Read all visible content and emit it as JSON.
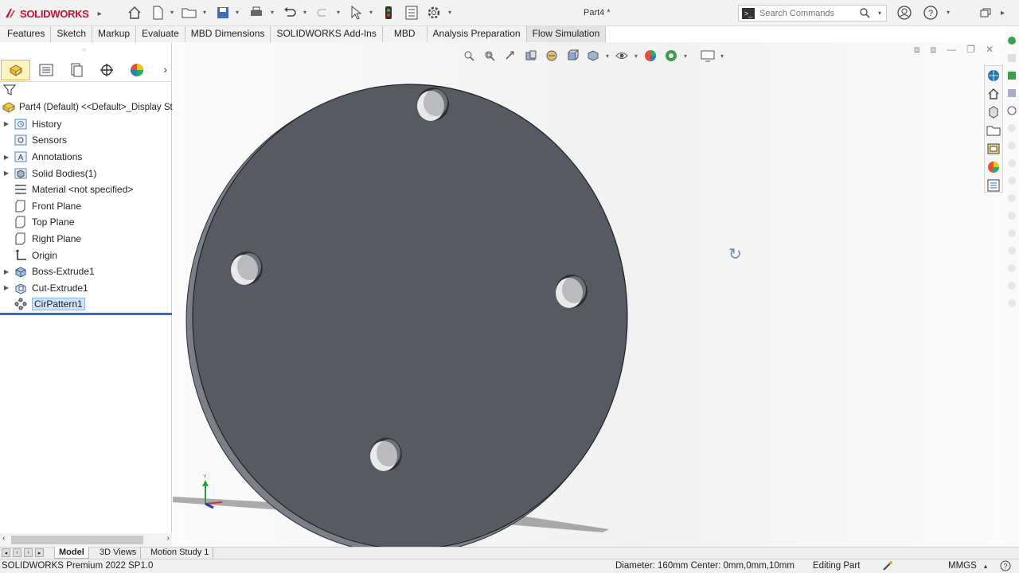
{
  "app": {
    "brand": "SOLIDWORKS",
    "document_title": "Part4 *"
  },
  "search": {
    "placeholder": "Search Commands"
  },
  "command_tabs": [
    "Features",
    "Sketch",
    "Markup",
    "Evaluate",
    "MBD Dimensions",
    "SOLIDWORKS Add-Ins",
    "MBD",
    "Analysis Preparation",
    "Flow Simulation"
  ],
  "feature_tree": {
    "root": "Part4 (Default) <<Default>_Display Sta",
    "items": [
      {
        "label": "History",
        "icon": "history-folder-icon",
        "expandable": true
      },
      {
        "label": "Sensors",
        "icon": "sensor-icon",
        "expandable": false
      },
      {
        "label": "Annotations",
        "icon": "annotations-icon",
        "expandable": true
      },
      {
        "label": "Solid Bodies(1)",
        "icon": "solid-bodies-icon",
        "expandable": true
      },
      {
        "label": "Material <not specified>",
        "icon": "material-icon",
        "expandable": false
      },
      {
        "label": "Front Plane",
        "icon": "plane-icon",
        "expandable": false
      },
      {
        "label": "Top Plane",
        "icon": "plane-icon",
        "expandable": false
      },
      {
        "label": "Right Plane",
        "icon": "plane-icon",
        "expandable": false
      },
      {
        "label": "Origin",
        "icon": "origin-icon",
        "expandable": false
      },
      {
        "label": "Boss-Extrude1",
        "icon": "boss-extrude-icon",
        "expandable": true
      },
      {
        "label": "Cut-Extrude1",
        "icon": "cut-extrude-icon",
        "expandable": true
      },
      {
        "label": "CirPattern1",
        "icon": "circular-pattern-icon",
        "expandable": false,
        "selected": true
      }
    ]
  },
  "bottom_tabs": [
    "Model",
    "3D Views",
    "Motion Study 1"
  ],
  "status": {
    "product": "SOLIDWORKS Premium 2022 SP1.0",
    "measure": "Diameter: 160mm  Center: 0mm,0mm,10mm",
    "mode": "Editing Part",
    "units": "MMGS"
  },
  "colors": {
    "part_face": "#565a63",
    "part_edge": "#7b7f8a",
    "brand_red": "#c8102e",
    "selection_blue": "#cfe4fb"
  }
}
